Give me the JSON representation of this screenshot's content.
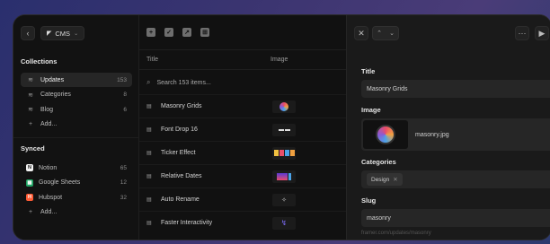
{
  "sidebar": {
    "back_icon": "chevron-left-icon",
    "cms_label": "CMS",
    "collections_title": "Collections",
    "collections": [
      {
        "label": "Updates",
        "count": "153",
        "active": true
      },
      {
        "label": "Categories",
        "count": "8"
      },
      {
        "label": "Blog",
        "count": "6"
      }
    ],
    "add_label": "Add...",
    "synced_title": "Synced",
    "synced": [
      {
        "label": "Notion",
        "count": "65",
        "badge": "N",
        "color": "#f2f2f2",
        "text": "#111"
      },
      {
        "label": "Google Sheets",
        "count": "12",
        "badge": "▦",
        "color": "#1fa463",
        "text": "#fff"
      },
      {
        "label": "Hubspot",
        "count": "32",
        "badge": "H",
        "color": "#ff5c35",
        "text": "#fff"
      }
    ],
    "synced_add_label": "Add..."
  },
  "table": {
    "col_title": "Title",
    "col_image": "Image",
    "search_placeholder": "Search 153 items...",
    "rows": [
      {
        "title": "Masonry Grids"
      },
      {
        "title": "Font Drop 16"
      },
      {
        "title": "Ticker Effect"
      },
      {
        "title": "Relative Dates"
      },
      {
        "title": "Auto Rename"
      },
      {
        "title": "Faster Interactivity"
      }
    ]
  },
  "detail": {
    "title_label": "Title",
    "title_value": "Masonry Grids",
    "image_label": "Image",
    "image_name": "masonry.jpg",
    "categories_label": "Categories",
    "category_tag": "Design",
    "slug_label": "Slug",
    "slug_value": "masonry",
    "url_text": "framer.com/updates/masonry"
  },
  "colors": {
    "accent_active": "#262626",
    "panel": "#1a1a1a"
  }
}
